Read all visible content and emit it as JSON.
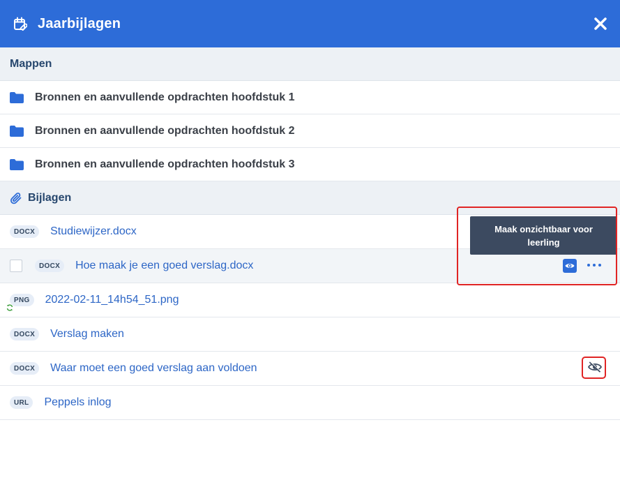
{
  "dialog": {
    "title": "Jaarbijlagen",
    "icon": "calendar-clip-icon",
    "close_icon": "close-icon"
  },
  "folders_section": {
    "label": "Mappen",
    "items": [
      {
        "label": "Bronnen en aanvullende opdrachten hoofdstuk 1",
        "icon": "folder-icon"
      },
      {
        "label": "Bronnen en aanvullende opdrachten hoofdstuk 2",
        "icon": "folder-icon"
      },
      {
        "label": "Bronnen en aanvullende opdrachten hoofdstuk 3",
        "icon": "folder-icon"
      }
    ]
  },
  "attachments_section": {
    "label": "Bijlagen",
    "icon": "paperclip-icon",
    "items": [
      {
        "type": "DOCX",
        "name": "Studiewijzer.docx"
      },
      {
        "type": "DOCX",
        "name": "Hoe maak je een goed verslag.docx",
        "hovered": true,
        "actions": [
          "eye-icon",
          "more-icon"
        ]
      },
      {
        "type": "PNG",
        "name": "2022-02-11_14h54_51.png",
        "status_icon": "sync-icon"
      },
      {
        "type": "DOCX",
        "name": "Verslag maken"
      },
      {
        "type": "DOCX",
        "name": "Waar moet een goed verslag aan voldoen",
        "actions": [
          "eye-slash-icon"
        ]
      },
      {
        "type": "URL",
        "name": "Peppels inlog"
      }
    ]
  },
  "tooltip": {
    "text": "Maak onzichtbaar voor leerling"
  },
  "colors": {
    "header": "#2d6cd8",
    "section_bg": "#edf1f5",
    "link": "#2d66c6",
    "tooltip_bg": "#3c4a60",
    "annotation": "#e02424"
  }
}
